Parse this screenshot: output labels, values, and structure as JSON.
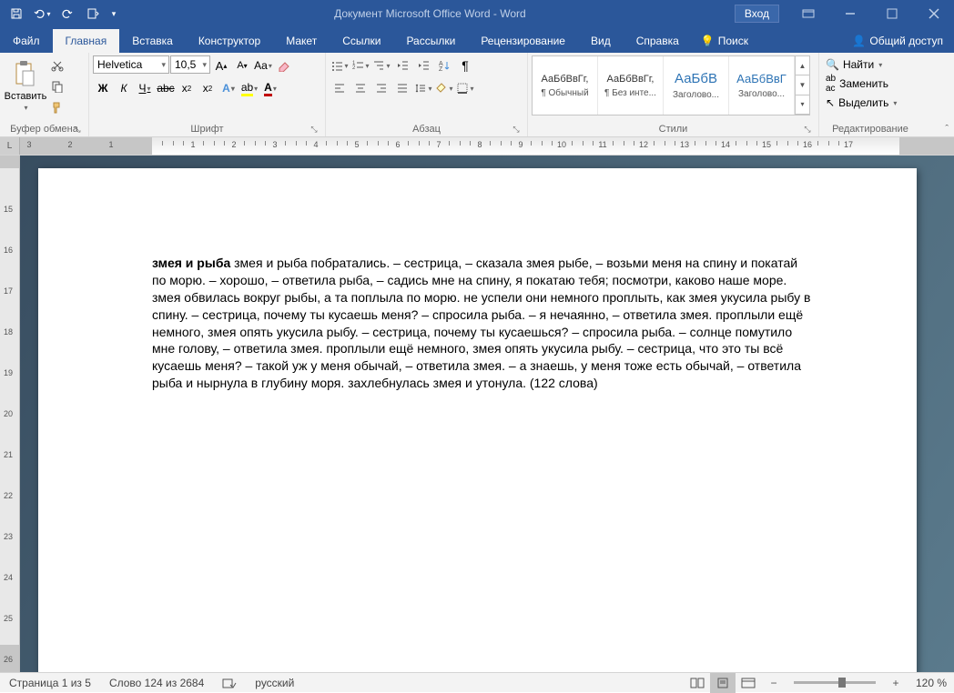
{
  "title": "Документ Microsoft Office Word  -  Word",
  "signin": "Вход",
  "tabs": {
    "file": "Файл",
    "home": "Главная",
    "insert": "Вставка",
    "design": "Конструктор",
    "layout": "Макет",
    "references": "Ссылки",
    "mailings": "Рассылки",
    "review": "Рецензирование",
    "view": "Вид",
    "help": "Справка",
    "tell_me": "Поиск",
    "share": "Общий доступ"
  },
  "clipboard": {
    "paste": "Вставить",
    "group": "Буфер обмена"
  },
  "font": {
    "name": "Helvetica",
    "size": "10,5",
    "group": "Шрифт",
    "bold": "Ж",
    "italic": "К",
    "underline": "Ч",
    "strike": "abc"
  },
  "paragraph": {
    "group": "Абзац"
  },
  "styles": {
    "group": "Стили",
    "items": [
      {
        "preview": "АаБбВвГг,",
        "name": "¶ Обычный",
        "blue": false
      },
      {
        "preview": "АаБбВвГг,",
        "name": "¶ Без инте...",
        "blue": false
      },
      {
        "preview": "АаБбВ",
        "name": "Заголово...",
        "blue": true
      },
      {
        "preview": "АаБбВвГ",
        "name": "Заголово...",
        "blue": true
      }
    ]
  },
  "editing": {
    "find": "Найти",
    "replace": "Заменить",
    "select": "Выделить",
    "group": "Редактирование"
  },
  "ruler": {
    "corner": "L",
    "numbers": [
      3,
      2,
      1,
      1,
      2,
      3,
      4,
      5,
      6,
      7,
      8,
      9,
      10,
      11,
      12,
      13,
      14,
      15,
      16,
      17
    ],
    "v_numbers": [
      "",
      "",
      "15",
      "16",
      "17",
      "18",
      "19",
      "20",
      "21",
      "22",
      "23",
      "24",
      "25",
      "26"
    ]
  },
  "document": {
    "bold_lead": "змея и рыба",
    "body": " змея и рыба побратались. – сестрица, – сказала змея рыбе, – возьми меня на спину и покатай по морю. – хорошо, – ответила рыба, – садись мне на спину, я покатаю тебя; посмотри, каково наше море. змея обвилась вокруг рыбы, а та поплыла по морю. не успели они немного проплыть, как змея укусила рыбу в спину. – сестрица, почему ты кусаешь меня? – спросила рыба. – я нечаянно, – ответила змея. проплыли ещё немного, змея опять укусила рыбу. – сестрица, почему ты кусаешься? – спросила рыба. – солнце помутило мне голову, – ответила змея. проплыли ещё немного, змея опять укусила рыбу. – сестрица, что это ты всё кусаешь меня? – такой уж у меня обычай, – ответила змея. – а знаешь, у меня тоже есть обычай, – ответила рыба и нырнула в глубину моря. захлебнулась змея и утонула. (122 слова)"
  },
  "status": {
    "page": "Страница 1 из 5",
    "words": "Слово 124 из 2684",
    "lang": "русский",
    "zoom": "120 %"
  }
}
